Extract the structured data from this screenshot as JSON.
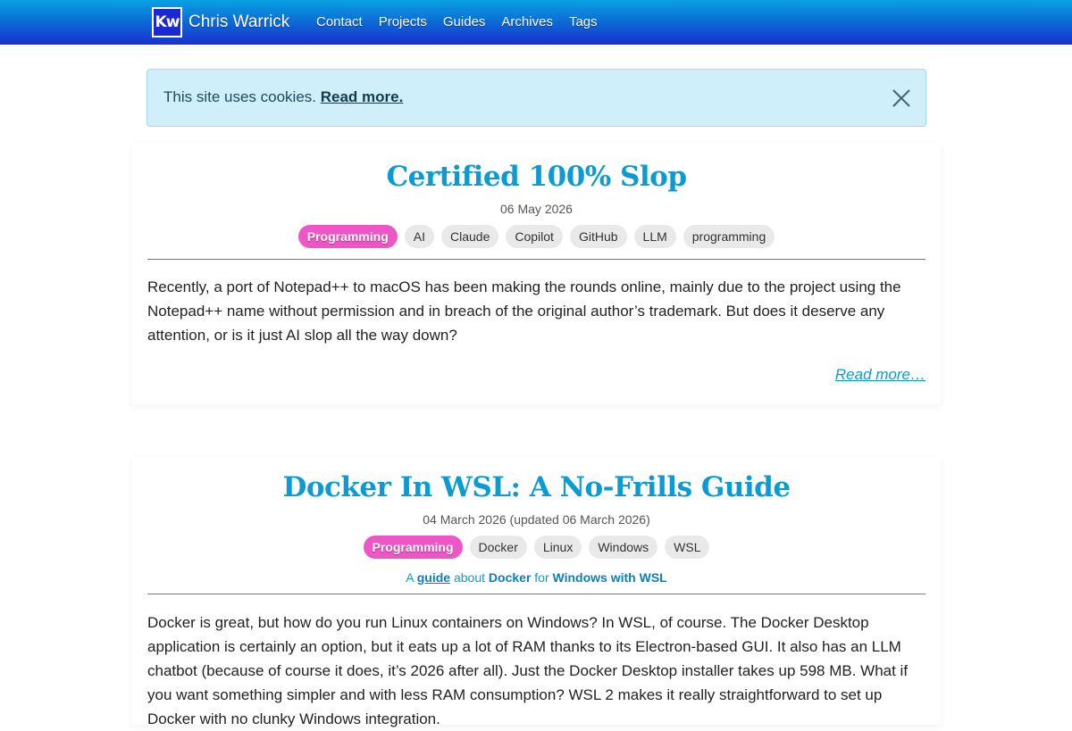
{
  "nav": {
    "logo_text": "Kw",
    "site_name": "Chris Warrick",
    "links": [
      "Contact",
      "Projects",
      "Guides",
      "Archives",
      "Tags"
    ]
  },
  "cookie_banner": {
    "text": "This site uses cookies.",
    "link_label": "Read more.",
    "close_icon": "close-icon"
  },
  "posts": [
    {
      "title": "Certified 100% Slop",
      "date": "06 May 2026",
      "tags": [
        "Programming",
        "AI",
        "Claude",
        "Copilot",
        "GitHub",
        "LLM",
        "programming"
      ],
      "excerpt": "Recently, a port of Notepad++ to macOS has been making the rounds online, mainly due to the project using the Notepad++ name without permission and in breach of the original author’s trademark. But does it deserve any attention, or is it just AI slop all the way down?",
      "read_more": "Read more…"
    },
    {
      "title": "Docker In WSL: A No-Frills Guide",
      "date": "04 March 2026 (updated 06 March 2026)",
      "tags": [
        "Programming",
        "Docker",
        "Linux",
        "Windows",
        "WSL"
      ],
      "guide": {
        "prefix": "A",
        "guide_word": "guide",
        "about": "about",
        "topic": "Docker",
        "for": "for",
        "platform": "Windows with WSL"
      },
      "excerpt": "Docker is great, but how do you run Linux containers on Windows? In WSL, of course. The Docker Desktop application is certainly an option, but it eats up a lot of RAM thanks to its Electron-based GUI. It also has an LLM chatbot (because of course it does, it’s 2026 after all). Just the Docker Desktop installer takes up 598 MB. What if you want something simpler and with less RAM consumption? WSL 2 makes it really straightforward to set up Docker with no clunky Windows integration."
    }
  ],
  "colors": {
    "nav_gradient_top": "#0aa2e4",
    "nav_gradient_bottom": "#1a2fcf",
    "accent": "#0b9bd2",
    "primary_tag": "#ee55c6",
    "cookie_bg": "#cff0fa"
  }
}
